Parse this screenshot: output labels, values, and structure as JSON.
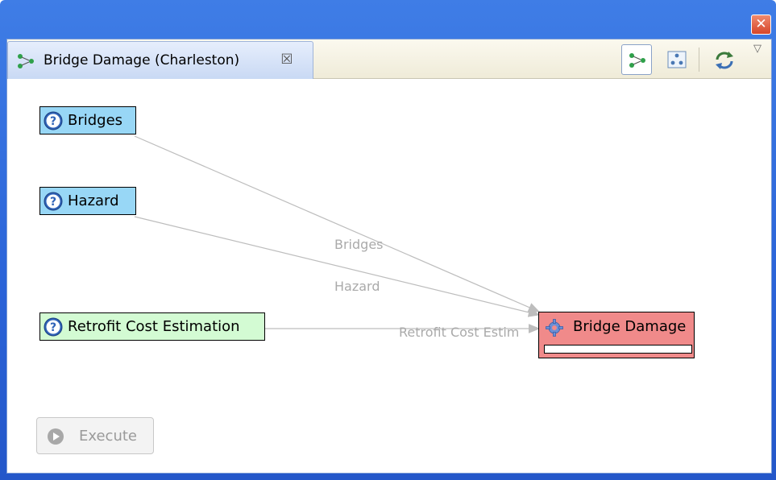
{
  "window": {
    "close_glyph": "✕"
  },
  "tab": {
    "title": "Bridge Damage (Charleston)",
    "close_glyph": "☒",
    "icon": "graph-view-icon"
  },
  "toolbar": {
    "buttons": [
      {
        "icon": "graph-layout-icon",
        "pressed": true
      },
      {
        "icon": "tree-layout-icon",
        "pressed": false
      },
      {
        "icon": "refresh-icon",
        "pressed": false
      }
    ],
    "menu_glyph": "▽"
  },
  "graph": {
    "inputs": [
      {
        "label": "Bridges",
        "icon": "help-icon",
        "color": "#98d7f6"
      },
      {
        "label": "Hazard",
        "icon": "help-icon",
        "color": "#98d7f6"
      },
      {
        "label": "Retrofit Cost Estimation",
        "icon": "help-icon",
        "color": "#d3fbd3"
      }
    ],
    "algorithm": {
      "label": "Bridge Damage",
      "icon": "gear-icon",
      "color": "#f08a8a",
      "progress": 0
    },
    "edges": [
      {
        "label": "Bridges"
      },
      {
        "label": "Hazard"
      },
      {
        "label": "Retrofit Cost Estim"
      }
    ]
  },
  "execute": {
    "label": "Execute",
    "enabled": false
  }
}
